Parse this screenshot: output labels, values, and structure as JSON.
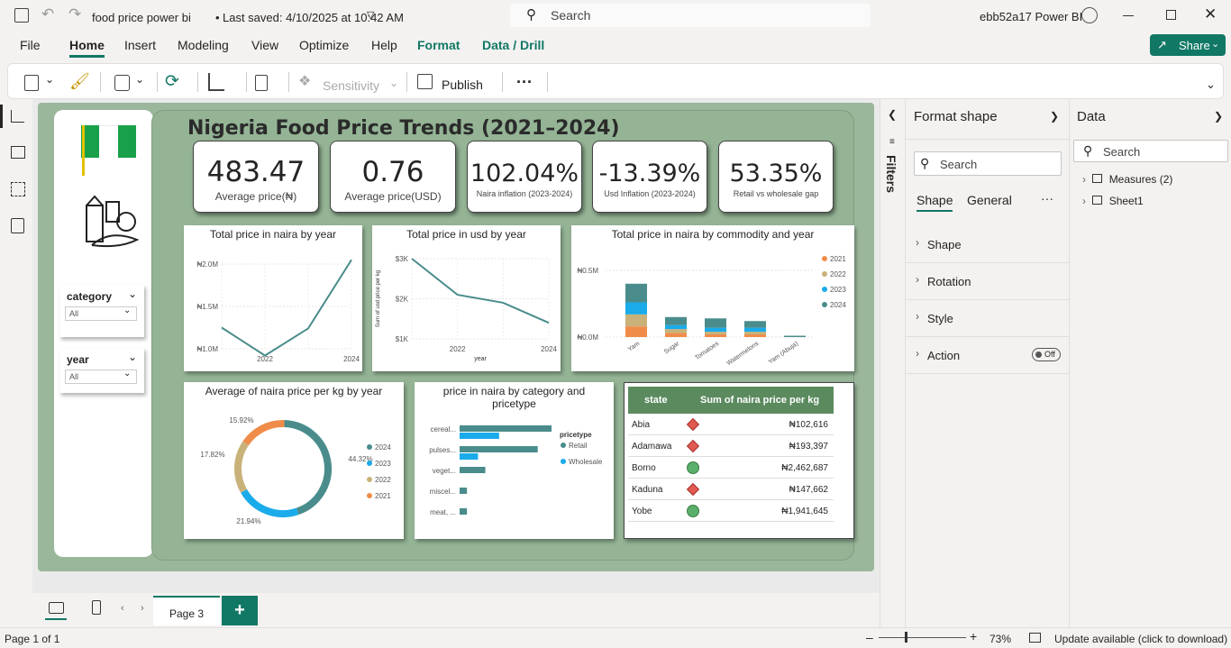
{
  "titlebar": {
    "file_name": "food price power bi",
    "saved": "Last saved: 4/10/2025 at 10:42 AM",
    "search_placeholder": "Search",
    "user": "ebb52a17 Power BI"
  },
  "ribbon": {
    "tabs": [
      "File",
      "Home",
      "Insert",
      "Modeling",
      "View",
      "Optimize",
      "Help",
      "Format",
      "Data / Drill"
    ],
    "share_label": "Share",
    "sensitivity_label": "Sensitivity",
    "publish_label": "Publish",
    "more_label": "···"
  },
  "report": {
    "title": "Nigeria Food Price Trends (2021–2024)",
    "kpis": [
      {
        "value": "483.47",
        "label": "Average price(₦)"
      },
      {
        "value": "0.76",
        "label": "Average price(USD)"
      },
      {
        "value": "102.04%",
        "label": "Naira inflation (2023-2024)"
      },
      {
        "value": "-13.39%",
        "label": "Usd Inflation (2023-2024)"
      },
      {
        "value": "53.35%",
        "label": "Retail vs wholesale gap"
      }
    ],
    "slicers": [
      {
        "title": "category",
        "value": "All"
      },
      {
        "title": "year",
        "value": "All"
      }
    ],
    "table": {
      "headers": [
        "state",
        "Sum of naira price per kg"
      ],
      "rows": [
        {
          "state": "Abia",
          "value": "₦102,616",
          "icon": "red-diamond"
        },
        {
          "state": "Adamawa",
          "value": "₦193,397",
          "icon": "red-diamond"
        },
        {
          "state": "Borno",
          "value": "₦2,462,687",
          "icon": "green-circle"
        },
        {
          "state": "Kaduna",
          "value": "₦147,662",
          "icon": "red-diamond"
        },
        {
          "state": "Yobe",
          "value": "₦1,941,645",
          "icon": "green-circle"
        }
      ]
    }
  },
  "chart_data": [
    {
      "type": "line",
      "title": "Total price in naira by year",
      "x": [
        2021,
        2022,
        2023,
        2024
      ],
      "x_tick_labels": [
        "2022",
        "2024"
      ],
      "y_tick_labels": [
        "₦1.0M",
        "₦1.5M",
        "₦2.0M"
      ],
      "ylim": [
        1.0,
        2.0
      ],
      "series": [
        {
          "values": [
            1.25,
            0.92,
            1.24,
            2.05
          ]
        }
      ],
      "color": "#4a8c8c"
    },
    {
      "type": "line",
      "title": "Total price in usd by year",
      "xlabel": "year",
      "ylabel": "Sum of usd price per kg",
      "x": [
        2021,
        2022,
        2023,
        2024
      ],
      "x_tick_labels": [
        "2022",
        "2024"
      ],
      "y_tick_labels": [
        "$1K",
        "$2K",
        "$3K"
      ],
      "ylim": [
        1,
        3
      ],
      "series": [
        {
          "values": [
            3.0,
            2.1,
            1.9,
            1.4
          ]
        }
      ],
      "color": "#4a8c8c"
    },
    {
      "type": "bar",
      "stacked": true,
      "title": "Total price in naira by commodity and year",
      "categories": [
        "Yam",
        "Sugar",
        "Tomatoes",
        "Watermelons",
        "Yam (Abuja)"
      ],
      "y_tick_labels": [
        "₦0.0M",
        "₦0.5M"
      ],
      "ylim": [
        0,
        0.5
      ],
      "legend": "right",
      "series": [
        {
          "name": "2021",
          "color": "#f08c4a",
          "values": [
            0.08,
            0.03,
            0.02,
            0.02,
            0.0
          ]
        },
        {
          "name": "2022",
          "color": "#c9b27a",
          "values": [
            0.09,
            0.03,
            0.02,
            0.02,
            0.0
          ]
        },
        {
          "name": "2023",
          "color": "#1aabea",
          "values": [
            0.09,
            0.03,
            0.03,
            0.03,
            0.0
          ]
        },
        {
          "name": "2024",
          "color": "#4a8c8c",
          "values": [
            0.14,
            0.06,
            0.07,
            0.05,
            0.01
          ]
        }
      ]
    },
    {
      "type": "pie",
      "donut": true,
      "title": "Average of naira price per kg by year",
      "legend": "right",
      "slices": [
        {
          "label": "2024",
          "value": 44.32,
          "text": "44.32%",
          "color": "#4a8c8c"
        },
        {
          "label": "2023",
          "value": 21.94,
          "text": "21.94%",
          "color": "#1aabea"
        },
        {
          "label": "2022",
          "value": 17.82,
          "text": "17.82%",
          "color": "#c9b27a"
        },
        {
          "label": "2021",
          "value": 15.92,
          "text": "15.92%",
          "color": "#f08c4a"
        }
      ]
    },
    {
      "type": "bar",
      "orientation": "horizontal",
      "title": "price in naira by category and pricetype",
      "legend_title": "pricetype",
      "categories": [
        "cereal...",
        "pulses...",
        "veget...",
        "miscel...",
        "meat, ..."
      ],
      "series": [
        {
          "name": "Retail",
          "color": "#4a8c8c",
          "values": [
            100,
            85,
            28,
            8,
            8
          ]
        },
        {
          "name": "Wholesale",
          "color": "#1aabea",
          "values": [
            43,
            20,
            0,
            0,
            0
          ]
        }
      ]
    }
  ],
  "format_pane": {
    "title": "Format shape",
    "search_placeholder": "Search",
    "tabs": [
      "Shape",
      "General"
    ],
    "sections": [
      "Shape",
      "Rotation",
      "Style",
      "Action"
    ],
    "toggle_label": "Off"
  },
  "filters_label": "Filters",
  "data_pane": {
    "title": "Data",
    "search_placeholder": "Search",
    "items": [
      "Measures (2)",
      "Sheet1"
    ]
  },
  "pagebar": {
    "page_label": "Page 3",
    "add_label": "+"
  },
  "statusbar": {
    "page_info": "Page 1 of 1",
    "zoom": "73%",
    "update": "Update available (click to download)"
  }
}
